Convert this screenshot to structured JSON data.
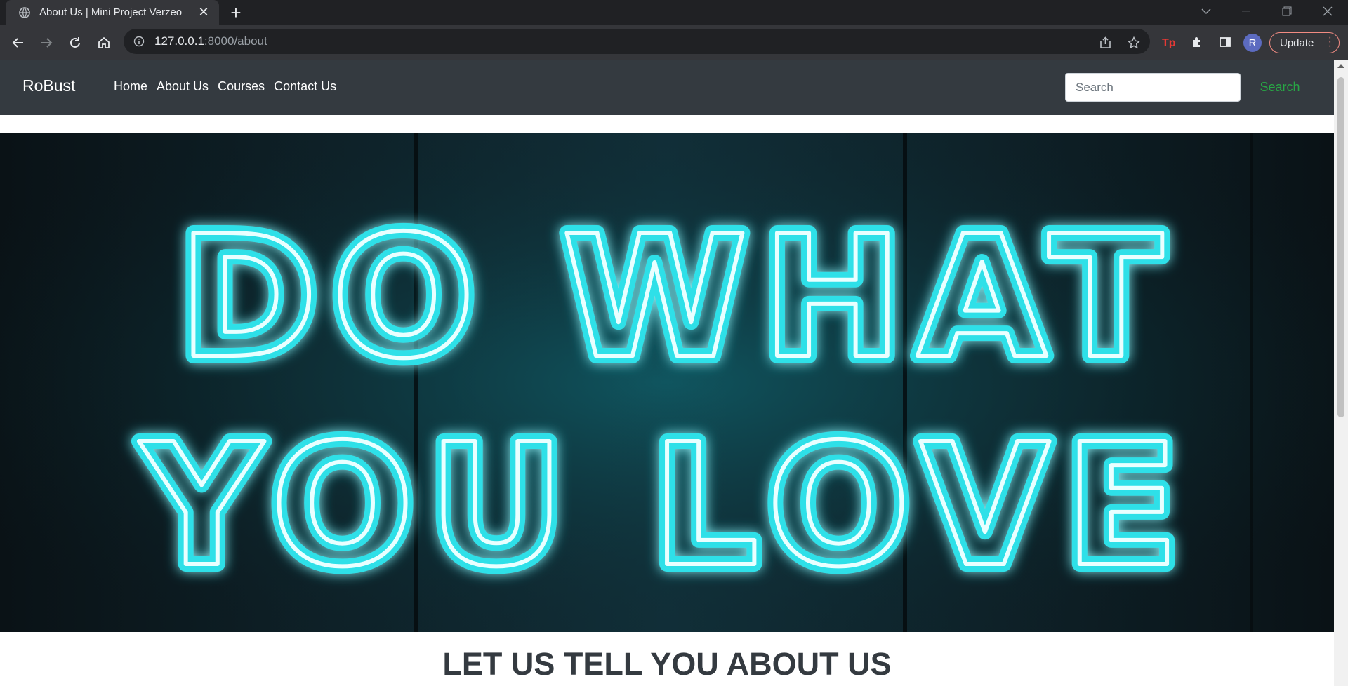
{
  "browser": {
    "tab_title": "About Us | Mini Project Verzeo",
    "url_host": "127.0.0.1",
    "url_rest": ":8000/about",
    "update_label": "Update",
    "profile_initial": "R"
  },
  "navbar": {
    "brand": "RoBust",
    "links": [
      "Home",
      "About Us",
      "Courses",
      "Contact Us"
    ],
    "search_placeholder": "Search",
    "search_button": "Search"
  },
  "hero": {
    "line1": "DO WHAT",
    "line2": "YOU LOVE",
    "neon_color": "#2de0e8"
  },
  "section": {
    "heading": "LET US TELL YOU ABOUT US"
  },
  "colors": {
    "navbar_bg": "#343a40",
    "search_button": "#28a745",
    "browser_frame": "#202124",
    "browser_toolbar": "#35363a"
  }
}
